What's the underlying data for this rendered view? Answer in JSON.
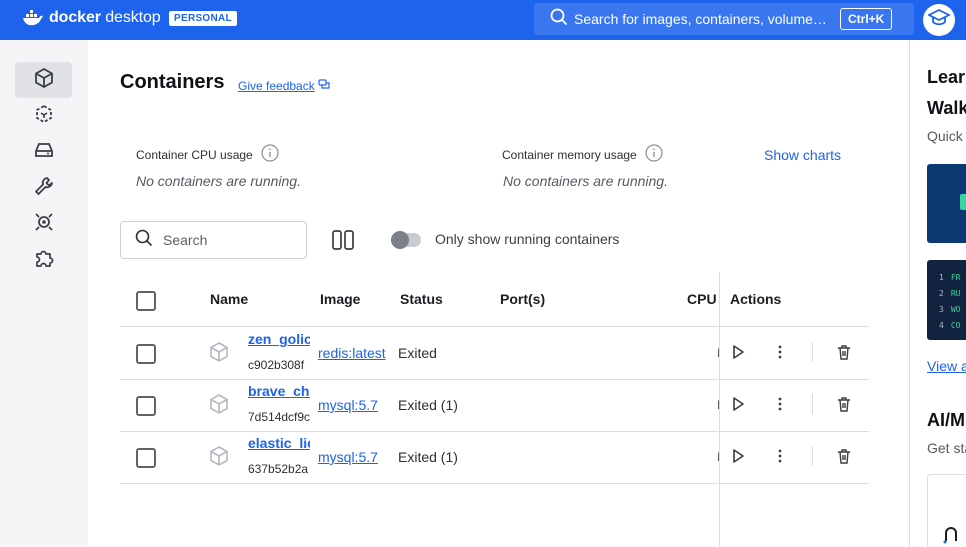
{
  "app": {
    "brand_bold": "docker",
    "brand_light": "desktop",
    "plan_badge": "PERSONAL",
    "search_placeholder": "Search for images, containers, volumes, extensions and more...",
    "search_shortcut": "Ctrl+K"
  },
  "sidebar": {
    "items": [
      {
        "name": "containers",
        "icon": "container-cube-icon",
        "active": true
      },
      {
        "name": "images",
        "icon": "images-icon",
        "active": false
      },
      {
        "name": "volumes",
        "icon": "volumes-icon",
        "active": false
      },
      {
        "name": "builds",
        "icon": "wrench-icon",
        "active": false
      },
      {
        "name": "scout",
        "icon": "scout-icon",
        "active": false
      },
      {
        "name": "extensions",
        "icon": "puzzle-icon",
        "active": false
      }
    ]
  },
  "main": {
    "title": "Containers",
    "feedback_link": "Give feedback",
    "cpu_label": "Container CPU usage",
    "cpu_empty": "No containers are running.",
    "memory_label": "Container memory usage",
    "memory_empty": "No containers are running.",
    "show_charts": "Show charts",
    "search_placeholder": "Search",
    "toggle_label": "Only show running containers",
    "toggle_on": false
  },
  "table": {
    "headers": {
      "name": "Name",
      "image": "Image",
      "status": "Status",
      "ports": "Port(s)",
      "cpu": "CPU",
      "actions": "Actions"
    },
    "rows": [
      {
        "name": "zen_golick",
        "id": "c902b308f",
        "image": "redis:latest",
        "status": "Exited",
        "cpu": "N/A"
      },
      {
        "name": "brave_chatelet",
        "id": "7d514dcf9c",
        "image": "mysql:5.7",
        "status": "Exited (1)",
        "cpu": "N/A"
      },
      {
        "name": "elastic_lichterman",
        "id": "637b52b2a",
        "image": "mysql:5.7",
        "status": "Exited (1)",
        "cpu": "N/A"
      }
    ]
  },
  "right_panel": {
    "heading1": "Learn",
    "heading2": "Walkthroughs",
    "subtitle": "Quick",
    "code_lines": [
      "1",
      "2",
      "3",
      "4"
    ],
    "code_tokens": [
      "FR",
      "RU",
      "WO",
      "CO"
    ],
    "link": "View all",
    "heading3": "AI/ML",
    "subtitle2": "Get started"
  },
  "colors": {
    "brand_blue": "#1d63ed",
    "sidebar_bg": "#f5f5f7"
  }
}
